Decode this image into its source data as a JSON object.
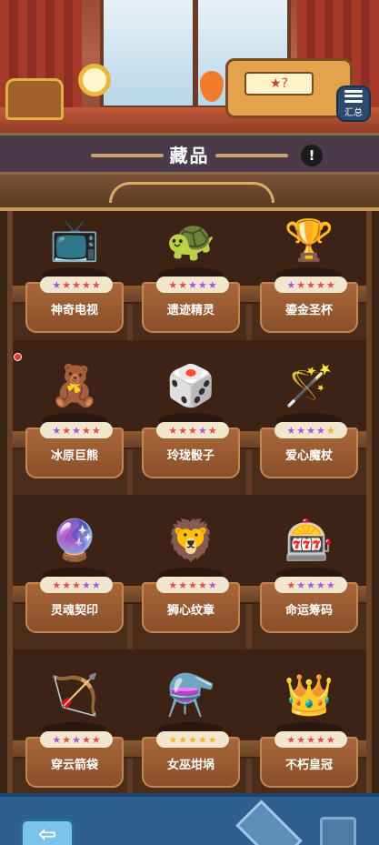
{
  "header": {
    "title": "藏品",
    "info_symbol": "!",
    "summary_label": "汇总",
    "register_screen": "★?"
  },
  "collection": [
    {
      "name": "神奇电视",
      "art": "📺",
      "stars": [
        "p",
        "r",
        "r",
        "r",
        "r"
      ]
    },
    {
      "name": "遗迹精灵",
      "art": "🐢",
      "stars": [
        "r",
        "r",
        "p",
        "p",
        "p"
      ]
    },
    {
      "name": "鎏金圣杯",
      "art": "🏆",
      "stars": [
        "p",
        "r",
        "r",
        "r",
        "r"
      ]
    },
    {
      "name": "冰原巨熊",
      "art": "🧸",
      "stars": [
        "p",
        "r",
        "p",
        "r",
        "r"
      ]
    },
    {
      "name": "玲珑骰子",
      "art": "🎲",
      "stars": [
        "r",
        "r",
        "r",
        "p",
        "r"
      ]
    },
    {
      "name": "爱心魔杖",
      "art": "🪄",
      "stars": [
        "p",
        "p",
        "p",
        "p",
        "y"
      ]
    },
    {
      "name": "灵魂契印",
      "art": "🔮",
      "stars": [
        "r",
        "r",
        "r",
        "p",
        "p"
      ]
    },
    {
      "name": "狮心纹章",
      "art": "🦁",
      "stars": [
        "r",
        "r",
        "r",
        "r",
        "p"
      ]
    },
    {
      "name": "命运筹码",
      "art": "🎰",
      "stars": [
        "r",
        "p",
        "p",
        "p",
        "p"
      ]
    },
    {
      "name": "穿云箭袋",
      "art": "🏹",
      "stars": [
        "p",
        "r",
        "p",
        "r",
        "r"
      ]
    },
    {
      "name": "女巫坩埚",
      "art": "⚗️",
      "stars": [
        "y",
        "y",
        "y",
        "y",
        "y"
      ]
    },
    {
      "name": "不朽皇冠",
      "art": "👑",
      "stars": [
        "r",
        "r",
        "r",
        "r",
        "r"
      ]
    }
  ],
  "colors": {
    "star_red": "#e24d4d",
    "star_purple": "#a35ae0",
    "star_yellow": "#f2b233"
  },
  "nav": {
    "back_symbol": "⇦"
  }
}
